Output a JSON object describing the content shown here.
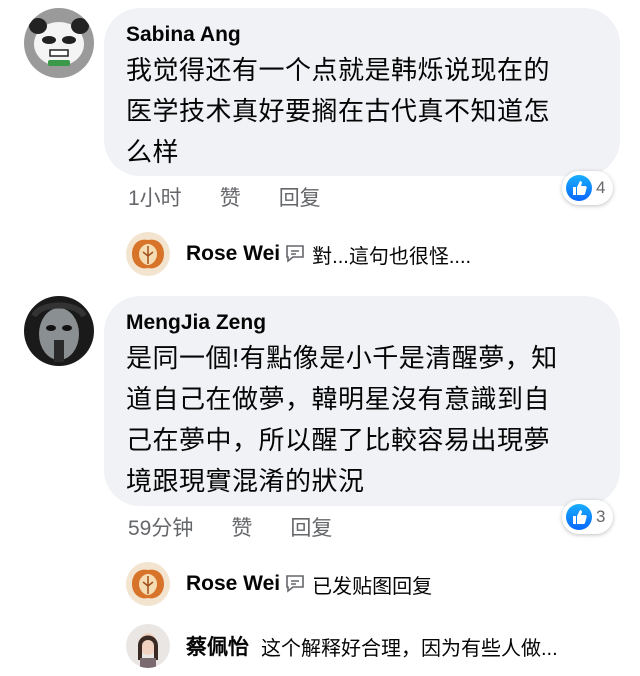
{
  "comments": [
    {
      "author": "Sabina Ang",
      "lines": [
        "我觉得还有一个点就是韩烁说现在的",
        "医学技术真好要搁在古代真不知道怎",
        "么样"
      ],
      "time": "1小时",
      "like_label": "赞",
      "reply_label": "回复",
      "reaction_count": "4",
      "reaction_icon": "like-icon",
      "reply": {
        "author": "Rose Wei",
        "text": "對...這句也很怪....",
        "icon": "reply-icon"
      }
    },
    {
      "author": "MengJia Zeng",
      "lines": [
        "是同一個!有點像是小千是清醒夢，知",
        "道自己在做夢，韓明星沒有意識到自",
        "己在夢中，所以醒了比較容易出現夢",
        "境跟現實混淆的狀況"
      ],
      "time": "59分钟",
      "like_label": "赞",
      "reply_label": "回复",
      "reaction_count": "3",
      "reaction_icon": "like-icon",
      "reply": {
        "author": "Rose Wei",
        "text": "已发贴图回复",
        "icon": "reply-icon"
      }
    }
  ],
  "extra_reply": {
    "author": "蔡佩怡",
    "text": "这个解释好合理，因为有些人做..."
  },
  "colors": {
    "bubble": "#f0f2f5",
    "meta_text": "#65676b",
    "like_blue": "#0866ff"
  }
}
